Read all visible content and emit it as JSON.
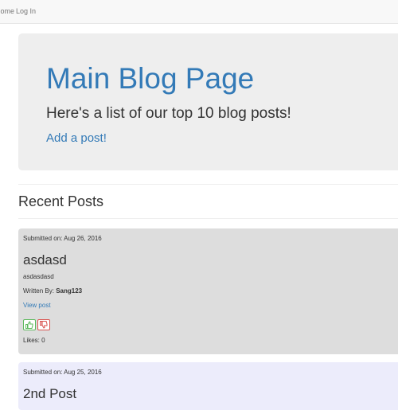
{
  "navbar": {
    "home_label": "Home",
    "login_label": "Log In"
  },
  "jumbotron": {
    "title": "Main Blog Page",
    "subtitle": "Here's a list of our top 10 blog posts!",
    "add_post_label": "Add a post!"
  },
  "section": {
    "title": "Recent Posts"
  },
  "posts": [
    {
      "submitted_on": "Submitted on: Aug 26, 2016",
      "title": "asdasd",
      "body": "asdasdasd",
      "written_by_label": "Written By: ",
      "author": "Sang123",
      "view_label": "View post",
      "upvote_icon": "thumbs-up-icon",
      "downvote_icon": "thumbs-down-icon",
      "likes": "Likes: 0",
      "background": "#dddddd"
    },
    {
      "submitted_on": "Submitted on: Aug 25, 2016",
      "title": "2nd Post",
      "background": "#ececfb"
    }
  ],
  "colors": {
    "link": "#337ab7",
    "upvote": "#5cb85c",
    "downvote": "#d9534f"
  }
}
